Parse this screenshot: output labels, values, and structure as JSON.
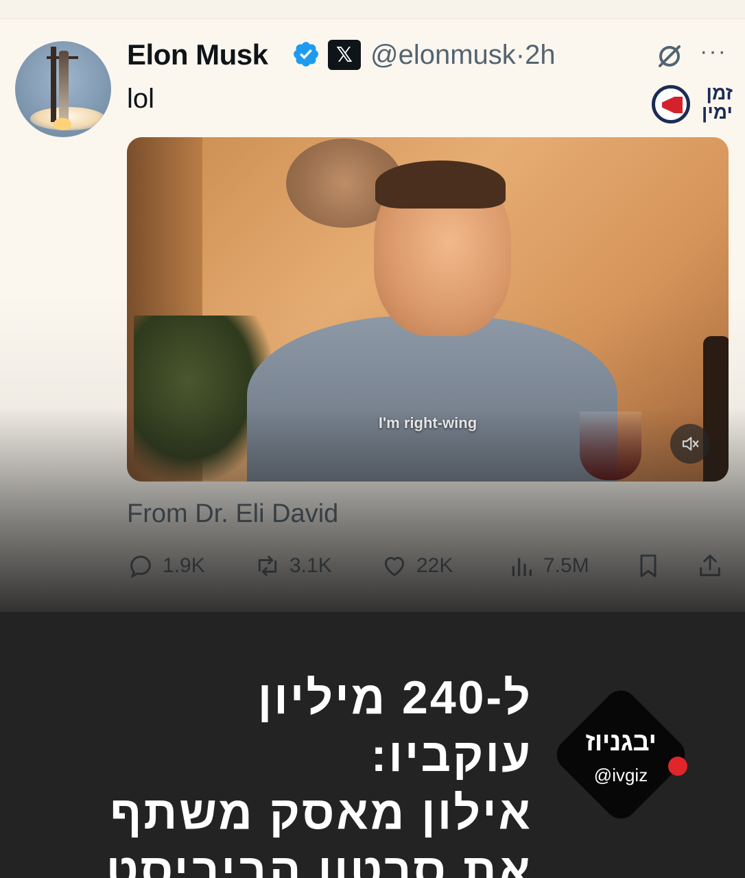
{
  "tweet": {
    "author_name": "Elon Musk",
    "handle": "@elonmusk",
    "separator": "·",
    "time": "2h",
    "text": "lol",
    "video_caption": "I'm right-wing",
    "source": "From Dr. Eli David",
    "stats": {
      "replies": "1.9K",
      "reposts": "3.1K",
      "likes": "22K",
      "views": "7.5M"
    }
  },
  "icons": {
    "verified": "verified-badge-icon",
    "x_logo": "x-logo-icon",
    "grok": "grok-icon",
    "more": "more-icon",
    "mute": "mute-icon",
    "reply": "reply-icon",
    "repost": "repost-icon",
    "like": "heart-icon",
    "views": "views-icon",
    "bookmark": "bookmark-icon",
    "share": "share-icon"
  },
  "x_badge_text": "𝕏",
  "more_text": "···",
  "zman_yamin": {
    "line1": "זמן",
    "line2": "ימין"
  },
  "overlay": {
    "headline_line1": "ל-240 מיליון עוקביו:",
    "headline_line2": "אילון מאסק משתף",
    "headline_line3": "את סרטון הביביסט"
  },
  "ivgiz": {
    "name": "יבגניוז",
    "handle": "@ivgiz"
  },
  "colors": {
    "verified_blue": "#1d9bf0",
    "muted_text": "#536471",
    "overlay_bg": "#232323",
    "ivgiz_dot": "#e0252b",
    "zman_navy": "#1b2c55",
    "zman_red": "#d3222a"
  }
}
